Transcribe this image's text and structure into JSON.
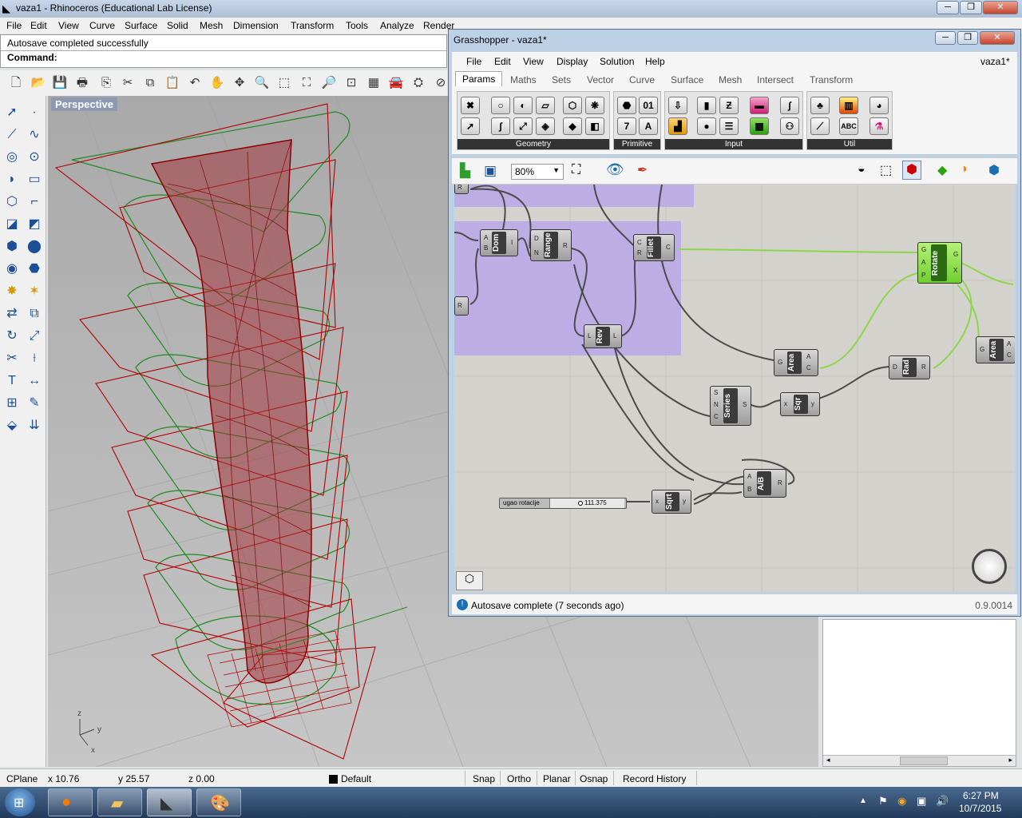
{
  "rhino": {
    "window_title": "vaza1 - Rhinoceros (Educational Lab License)",
    "menu": [
      "File",
      "Edit",
      "View",
      "Curve",
      "Surface",
      "Solid",
      "Mesh",
      "Dimension",
      "Transform",
      "Tools",
      "Analyze",
      "Render",
      "Help"
    ],
    "command_history": "Autosave completed successfully",
    "command_prompt": "Command:",
    "viewport_label": "Perspective",
    "axis_labels": {
      "z": "z",
      "y": "y",
      "x": "x"
    }
  },
  "status_bar": {
    "cplane": "CPlane",
    "x": "x 10.76",
    "y": "y 25.57",
    "z": "z 0.00",
    "layer": "Default",
    "toggles": [
      "Snap",
      "Ortho",
      "Planar",
      "Osnap",
      "Record History"
    ]
  },
  "taskbar": {
    "time": "6:27 PM",
    "date": "10/7/2015"
  },
  "grasshopper": {
    "window_title": "Grasshopper - vaza1*",
    "menu": [
      "File",
      "Edit",
      "View",
      "Display",
      "Solution",
      "Help"
    ],
    "doc_name": "vaza1*",
    "tabs": [
      "Params",
      "Maths",
      "Sets",
      "Vector",
      "Curve",
      "Surface",
      "Mesh",
      "Intersect",
      "Transform"
    ],
    "active_tab": "Params",
    "ribbon_groups": [
      "Geometry",
      "Primitive",
      "Input",
      "Util"
    ],
    "zoom": "80%",
    "status_message": "Autosave complete (7 seconds ago)",
    "version": "0.9.0014",
    "components": {
      "dom": {
        "name": "Dom",
        "in": [
          "A",
          "B"
        ],
        "out": [
          "I"
        ]
      },
      "range": {
        "name": "Range",
        "in": [
          "D",
          "N"
        ],
        "out": [
          "R"
        ]
      },
      "fillet": {
        "name": "Fillet",
        "in": [
          "C",
          "R"
        ],
        "out": [
          "C"
        ]
      },
      "rotate": {
        "name": "Rotate",
        "in": [
          "G",
          "A",
          "P"
        ],
        "out": [
          "G",
          "X"
        ]
      },
      "rev": {
        "name": "Rev",
        "in": [
          "L"
        ],
        "out": [
          "L"
        ]
      },
      "area1": {
        "name": "Area",
        "in": [
          "G"
        ],
        "out": [
          "A",
          "C"
        ]
      },
      "area2": {
        "name": "Area",
        "in": [
          "G"
        ],
        "out": [
          "A",
          "C"
        ]
      },
      "rad": {
        "name": "Rad",
        "in": [
          "D"
        ],
        "out": [
          "R"
        ]
      },
      "series": {
        "name": "Series",
        "in": [
          "S",
          "N",
          "C"
        ],
        "out": [
          "S"
        ]
      },
      "sqr": {
        "name": "Sqr",
        "in": [
          "x"
        ],
        "out": [
          "y"
        ]
      },
      "ab": {
        "name": "A/B",
        "in": [
          "A",
          "B"
        ],
        "out": [
          "R"
        ]
      },
      "sqrt": {
        "name": "Sqrt",
        "in": [
          "x"
        ],
        "out": [
          "y"
        ]
      },
      "slider_label": "ugao rotacije",
      "slider_value": "111.375",
      "r_param_a": "R",
      "r_param_b": "R"
    }
  }
}
